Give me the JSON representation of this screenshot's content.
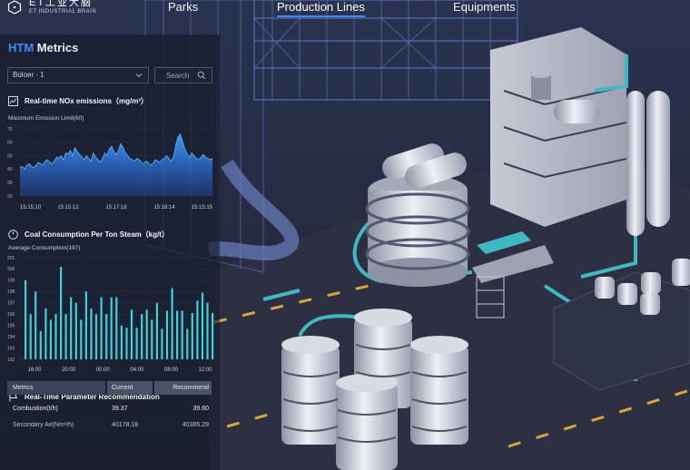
{
  "header": {
    "logo_cn": "ET工业大脑",
    "logo_en": "ET INDUSTRIAL BRAIN",
    "nav": [
      {
        "label": "Parks",
        "active": false
      },
      {
        "label": "Production Lines",
        "active": true
      },
      {
        "label": "Equipments",
        "active": false
      }
    ]
  },
  "panel": {
    "title_prefix": "HTM",
    "title_rest": " Metrics",
    "boiler_select": "Boloer - 1",
    "search_placeholder": "Search"
  },
  "nox": {
    "title": "Real-time NOx emissions（mg/m³）",
    "subtitle": "Maximum Emission Limit(60)"
  },
  "coal": {
    "title": "Coal Consumption Per Ton Steam（kg/t）",
    "subtitle": "Average Consumption(197)"
  },
  "recommend": {
    "title": "Real-Time Parameter Recommendation",
    "columns": [
      "Metrics",
      "Current",
      "Recommend"
    ],
    "rows": [
      {
        "metric": "Combustion(t/h)",
        "current": "39.37",
        "recommend": "39.60"
      },
      {
        "metric": "Secondary Air(Nm³/h)",
        "current": "40178.18",
        "recommend": "40385.29"
      }
    ]
  },
  "chart_data": [
    {
      "type": "area",
      "title": "Real-time NOx emissions（mg/m³）",
      "subtitle": "Maximum Emission Limit(60)",
      "ylim": [
        20,
        70
      ],
      "yticks": [
        20,
        30,
        40,
        50,
        60,
        70
      ],
      "xtick_labels": [
        "15:15:10",
        "15:15:12",
        "15:17:18",
        "15:18:14",
        "15:15:15"
      ],
      "values": [
        41,
        42,
        40,
        43,
        44,
        42,
        41,
        43,
        45,
        44,
        43,
        46,
        47,
        45,
        44,
        46,
        49,
        48,
        50,
        47,
        52,
        51,
        54,
        50,
        56,
        53,
        51,
        49,
        47,
        50,
        48,
        46,
        52,
        49,
        47,
        45,
        48,
        52,
        50,
        55,
        57,
        53,
        51,
        54,
        59,
        56,
        52,
        50,
        48,
        47,
        46,
        48,
        47,
        45,
        44,
        46,
        45,
        43,
        44,
        47,
        46,
        45,
        47,
        48,
        50,
        48,
        46,
        49,
        58,
        64,
        66,
        60,
        55,
        51,
        49,
        52,
        50,
        48,
        47,
        49,
        51,
        49,
        48,
        47,
        48
      ],
      "grid": true
    },
    {
      "type": "bar",
      "title": "Coal Consumption Per Ton Steam（kg/t）",
      "subtitle": "Average Consumption(197)",
      "ylim": [
        192,
        201
      ],
      "yticks": [
        192,
        193,
        194,
        195,
        196,
        197,
        198,
        199,
        200,
        201
      ],
      "xtick_labels": [
        "16:00",
        "20:00",
        "00:00",
        "04:00",
        "08:00",
        "12:00"
      ],
      "values": [
        199,
        196,
        198,
        194.5,
        196.5,
        195.5,
        196,
        200.2,
        196,
        197.5,
        197,
        195.5,
        198,
        196.5,
        196,
        197.5,
        196,
        197.5,
        197.5,
        195,
        194.8,
        196.4,
        194.8,
        196,
        196.4,
        195.5,
        197,
        194.7,
        196.3,
        198.3,
        196.3,
        196.3,
        194.7,
        196.1,
        197.2,
        197.9,
        197,
        196.1
      ],
      "grid": true
    }
  ]
}
